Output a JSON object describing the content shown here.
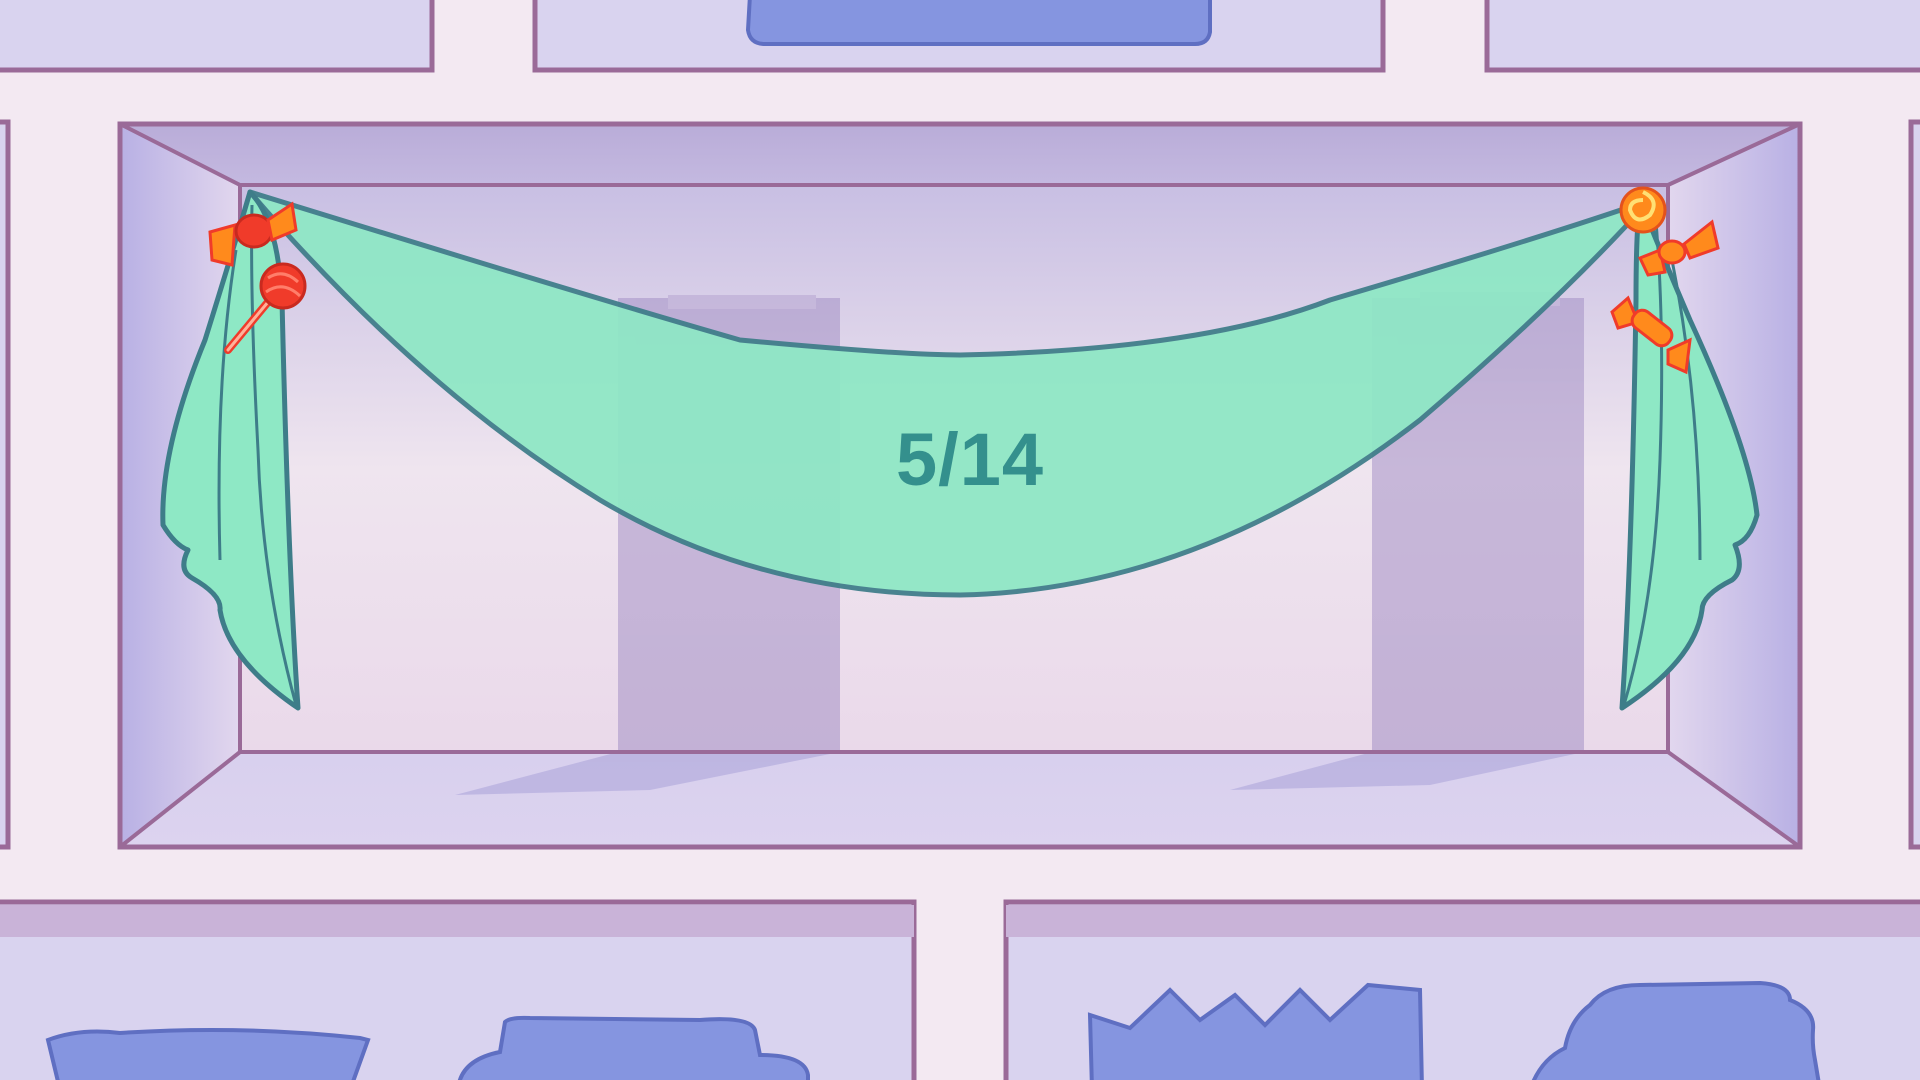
{
  "game": {
    "level_progress": "5/14",
    "colors": {
      "background": "#f3e9f2",
      "shelf_cell": "#d9d3ef",
      "frame": "#9a6a98",
      "drape": "#8ee8c5",
      "drape_outline": "#3e7d89",
      "silhouette": "#8595e0",
      "progress_text": "#34908d",
      "candy_red": "#f03b2a",
      "candy_orange": "#ff8a1c"
    },
    "icons": [
      "lollipop-icon",
      "wrapped-candy-icon",
      "swirl-candy-icon"
    ],
    "shelf_slots": [
      {
        "id": "top-left",
        "item": "none"
      },
      {
        "id": "top-middle",
        "item": "silhouette"
      },
      {
        "id": "top-right",
        "item": "none"
      },
      {
        "id": "display-center",
        "item": "drape"
      },
      {
        "id": "bottom-left",
        "item": "silhouette"
      },
      {
        "id": "bottom-right",
        "item": "silhouette"
      }
    ]
  }
}
